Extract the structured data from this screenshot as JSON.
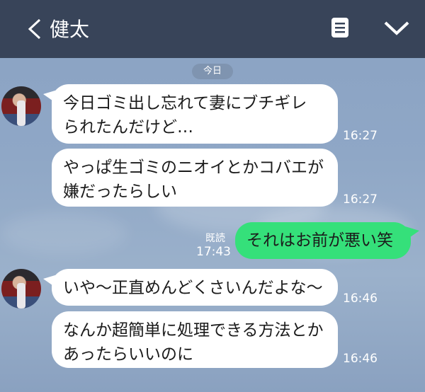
{
  "header": {
    "title": "健太",
    "back_icon": "chevron-left-icon",
    "note_icon": "note-icon",
    "menu_icon": "chevron-down-icon"
  },
  "date_badge": "今日",
  "messages": [
    {
      "side": "left",
      "text": "今日ゴミ出し忘れて妻にブチギレられたんだけど…",
      "line1": "今日ゴミ出し忘れて妻にブチギレ",
      "line2": "られたんだけど…",
      "time": "16:27"
    },
    {
      "side": "left",
      "text": "やっぱ生ゴミのニオイとかコバエが嫌だったらしい",
      "line1": "やっぱ生ゴミのニオイとかコバエが",
      "line2": "嫌だったらしい",
      "time": "16:27"
    },
    {
      "side": "right",
      "text": "それはお前が悪い笑",
      "read": "既読",
      "time": "17:43"
    },
    {
      "side": "left",
      "text": "いや〜正直めんどくさいんだよな〜",
      "time": "16:46"
    },
    {
      "side": "left",
      "text": "なんか超簡単に処理できる方法とかあったらいいのに",
      "line1": "なんか超簡単に処理できる方法とか",
      "line2": "あったらいいのに",
      "time": "16:46"
    }
  ],
  "colors": {
    "header": "#384459",
    "sent_bubble": "#35e07a",
    "received_bubble": "#ffffff",
    "background": "#8fa7c6"
  }
}
